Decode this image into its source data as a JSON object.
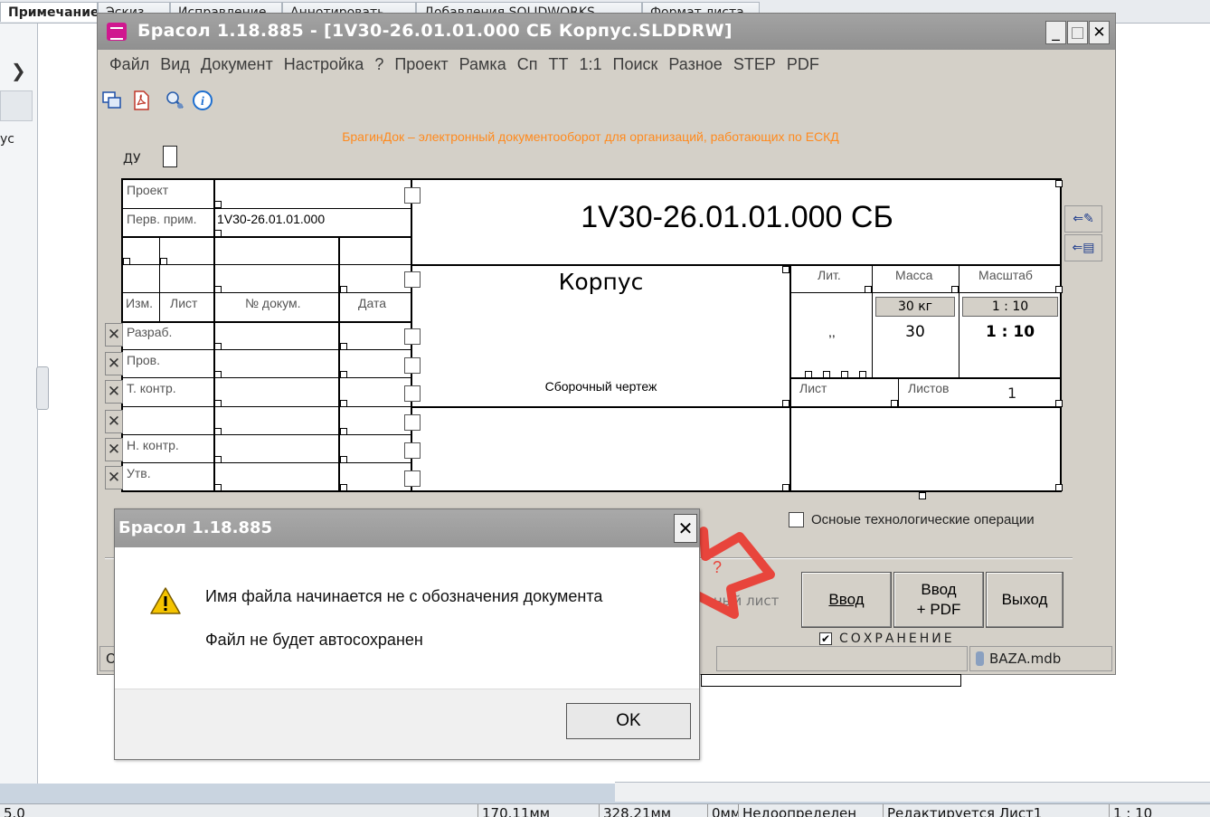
{
  "background_app": {
    "tabs": [
      "Примечание",
      "Эскиз",
      "Исправление",
      "Аннотировать",
      "Добавления SOLIDWORKS",
      "Формат листа"
    ],
    "sidebar_text": "ус",
    "statusbar": [
      "5.0",
      "170.11мм",
      "328.21мм",
      "0мм",
      "Недоопределен",
      "Редактируется Лист1",
      "1 : 10"
    ]
  },
  "main_window": {
    "title": "Брасол 1.18.885 - [1V30-26.01.01.000 СБ Корпус.SLDDRW]",
    "controls": {
      "minimize": "_",
      "maximize": "□",
      "close": "✕"
    },
    "menu": [
      "Файл",
      "Вид",
      "Документ",
      "Настройка",
      "?",
      "Проект",
      "Рамка",
      "Сп",
      "ТТ",
      "1:1",
      "Поиск",
      "Разное",
      "STEP",
      "PDF"
    ],
    "tagline": "БрагинДок – электронный документооборот для организаций, работающих по ЕСКД",
    "du_label": "ДУ"
  },
  "title_block": {
    "project_label": "Проект",
    "first_use_label": "Перв. прим.",
    "first_use_value": "1V30-26.01.01.000",
    "designation": "1V30-26.01.01.000 СБ",
    "name": "Корпус",
    "doc_type": "Сборочный чертеж",
    "columns": {
      "change": "Изм.",
      "sheet": "Лист",
      "doc_no": "№ докум.",
      "date": "Дата"
    },
    "roles": [
      "Разраб.",
      "Пров.",
      "Т. контр.",
      "",
      "Н. контр.",
      "Утв."
    ],
    "lit_label": "Лит.",
    "lit_value": ",,",
    "mass_label": "Масса",
    "mass_button": "30 кг",
    "mass_value": "30",
    "scale_label": "Масштаб",
    "scale_button": "1 : 10",
    "scale_value": "1 : 10",
    "sheet_label": "Лист",
    "sheets_label": "Листов",
    "sheets_value": "1"
  },
  "options": {
    "ops_label": "Осноые технологические операции",
    "next_sheet": "вный лист",
    "save_label": "СОХРАНЕНИЕ",
    "save_checked": true
  },
  "buttons": {
    "enter": "Ввод",
    "enter_pdf_1": "Ввод",
    "enter_pdf_2": "+ PDF",
    "exit": "Выход"
  },
  "status": {
    "left": "О",
    "db": "BAZA.mdb"
  },
  "dialog": {
    "title": "Брасол 1.18.885",
    "message1": "Имя файла начинается не с обозначения документа",
    "message2": "Файл не будет автосохранен",
    "ok": "OK",
    "close": "✕"
  },
  "annotation": {
    "arrow_color": "#e8453c",
    "question_mark": "?"
  },
  "colors": {
    "title_bar": "#9a9a9a",
    "window_face": "#d4d0c8",
    "tagline": "#ff8a1e",
    "brand_icon": "#d0178f"
  }
}
